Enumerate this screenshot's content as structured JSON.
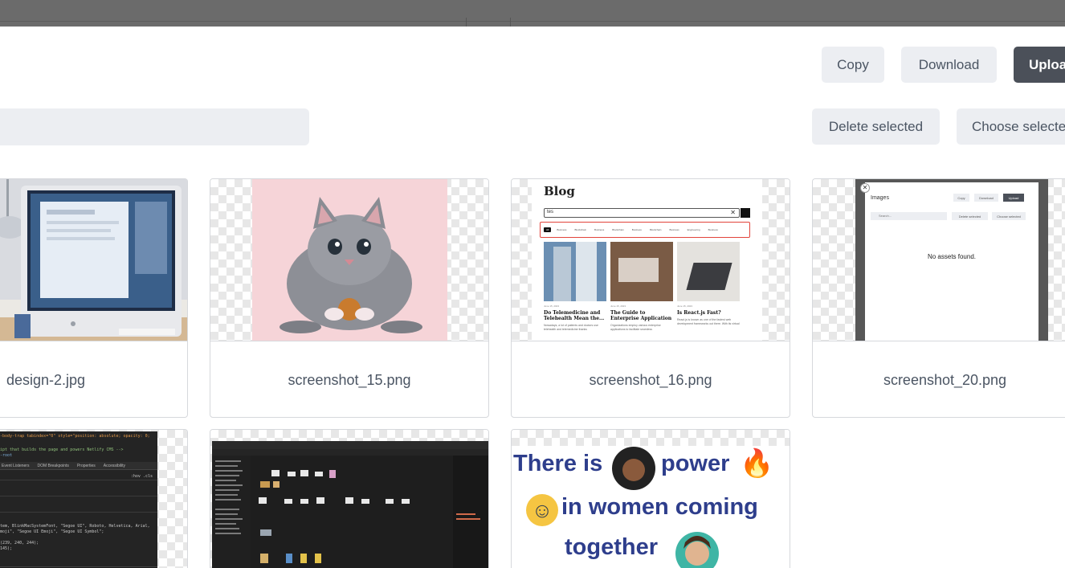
{
  "toolbar": {
    "copy_label": "Copy",
    "download_label": "Download",
    "upload_label": "Uploa"
  },
  "search": {
    "placeholder": ""
  },
  "actions": {
    "delete_label": "Delete selected",
    "choose_label": "Choose selecte"
  },
  "assets": [
    {
      "filename": "design-2.jpg"
    },
    {
      "filename": "screenshot_15.png"
    },
    {
      "filename": "screenshot_16.png"
    },
    {
      "filename": "screenshot_20.png"
    }
  ],
  "previews": {
    "blog": {
      "heading": "Blog",
      "search_text": "tes",
      "posts": [
        {
          "date": "June 15, 2023",
          "title": "Do Telemedicine and Telehealth Mean the...",
          "excerpt": "Nowadays, a lot of patients and doctors use telehealth and telemedicine thanks"
        },
        {
          "date": "June 15, 2023",
          "title": "The Guide to Enterprise Application Integration",
          "excerpt": "Organizations employ various enterprise applications to facilitate seamless"
        },
        {
          "date": "June 15, 2023",
          "title": "Is React.js Fast?",
          "excerpt": "React.js is known as one of the fastest web development frameworks out there. With its virtual single pag."
        }
      ],
      "tags": [
        "All",
        "Business",
        "Blockchain",
        "Business",
        "Blockchain",
        "Business",
        "Blockchain",
        "Business",
        "Engineering",
        "Business"
      ]
    },
    "images_modal": {
      "title": "Images",
      "copy": "Copy",
      "download": "Download",
      "upload": "Upload",
      "search_placeholder": "Search...",
      "delete": "Delete selected",
      "choose": "Choose selected",
      "empty": "No assets found."
    },
    "devtools": {
      "line1": "-body-trap tabindex=\"0\" style=\"position: absolute; opacity: 0;",
      "line2": "ipt that builds the page and powers Netlify CMS -->",
      "line3": "-root",
      "tabs": [
        "Event Listeners",
        "DOM Breakpoints",
        "Properties",
        "Accessibility"
      ],
      "filter": ":hov .cls",
      "css1": "tem, BlinkMacSystemFont, \"Segoe UI\", Roboto, Helvetica, Arial,",
      "css2": "moji\", \"Segoe UI Emoji\", \"Segoe UI Symbol\";",
      "css3": "(239, 240, 244);",
      "css4": "145);"
    },
    "women": {
      "line1a": "There is",
      "line1b": "power",
      "line2": "in women coming",
      "line3": "together"
    }
  }
}
